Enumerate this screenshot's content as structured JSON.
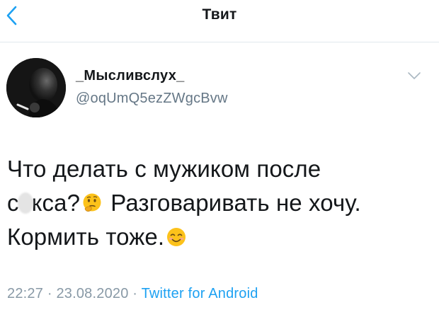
{
  "header": {
    "title": "Твит",
    "back_icon": "chevron-left-icon",
    "accent_color": "#1da1f2"
  },
  "author": {
    "display_name": "_Мысливслух_",
    "handle": "@oqUmQ5ezZWgcBvw",
    "menu_icon": "chevron-down-icon"
  },
  "tweet": {
    "line1": "Что делать с мужиком после",
    "line2_prefix": "с",
    "line2_mid": "кса?",
    "emoji_thinking": "thinking-face-icon",
    "line2_suffix": " Разговаривать не хочу.",
    "line3": "Кормить тоже.",
    "emoji_smile": "smiling-face-icon"
  },
  "meta": {
    "time": "22:27",
    "separator": " · ",
    "date": "23.08.2020",
    "source": "Twitter for Android"
  }
}
